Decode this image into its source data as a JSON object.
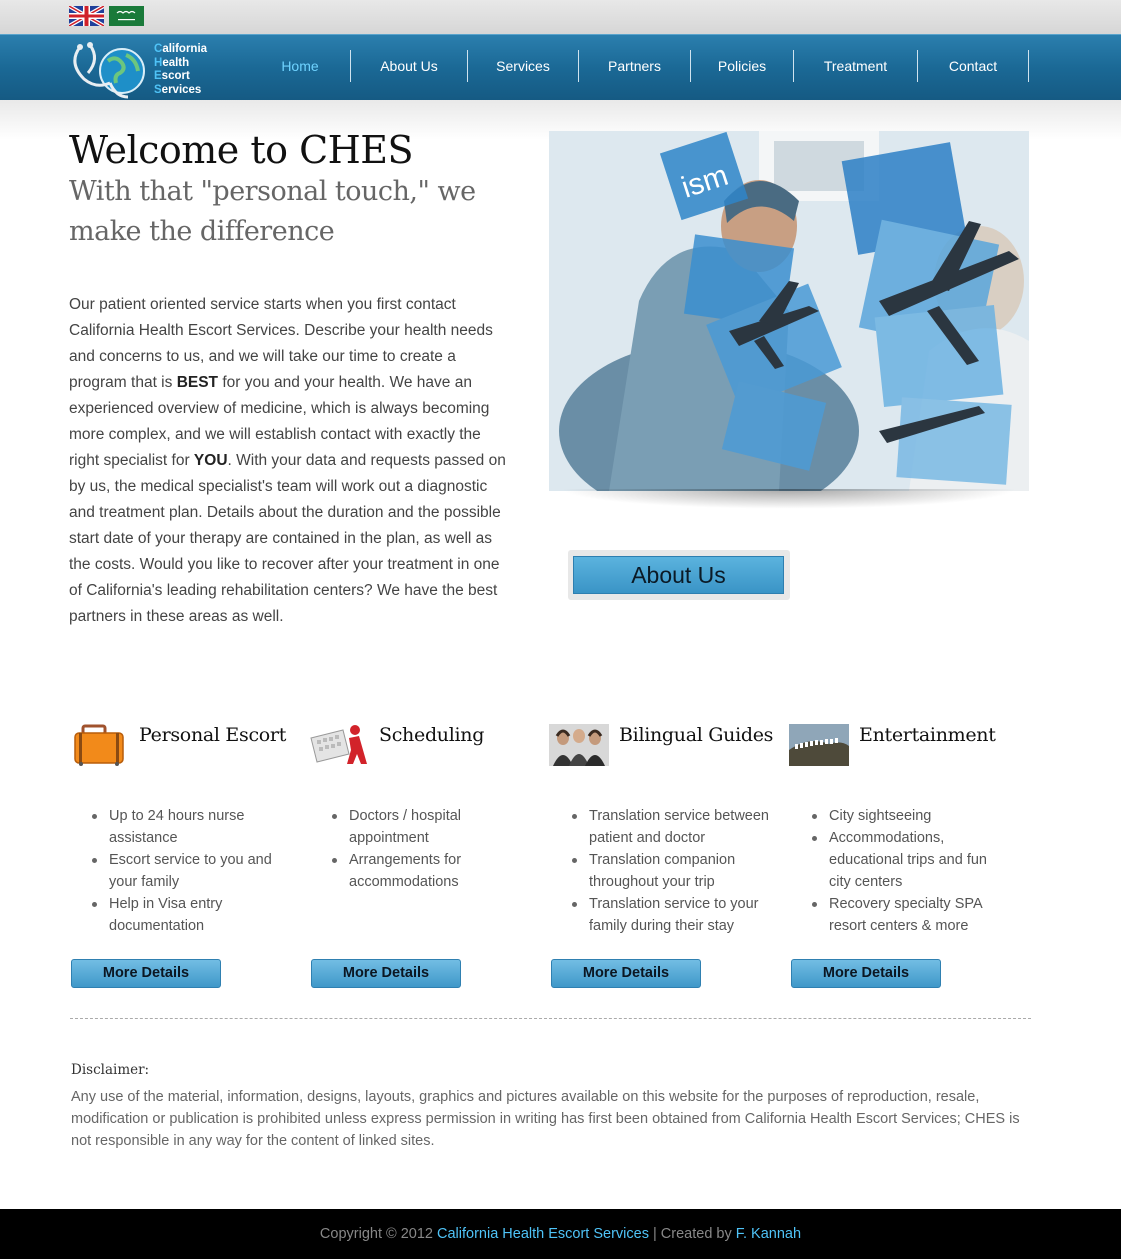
{
  "languages": [
    {
      "name": "english-flag-icon"
    },
    {
      "name": "arabic-flag-icon"
    }
  ],
  "logo": {
    "lines": [
      {
        "initial": "C",
        "rest": "alifornia"
      },
      {
        "initial": "H",
        "rest": "ealth"
      },
      {
        "initial": "E",
        "rest": "scort"
      },
      {
        "initial": "S",
        "rest": "ervices"
      }
    ]
  },
  "nav": {
    "items": [
      "Home",
      "About Us",
      "Services",
      "Partners",
      "Policies",
      "Treatment",
      "Contact"
    ],
    "active": "Home"
  },
  "welcome": {
    "title": "Welcome to CHES",
    "subtitle": "With that \"personal touch,\" we make the difference",
    "intro_parts": [
      "Our patient oriented service starts when you first contact California Health Escort Services. Describe your health needs and concerns to us, and we will take our time to create a program that is ",
      "BEST",
      " for you and your health. We have an experienced overview of medicine, which is always becoming more complex, and we will establish contact with exactly the right specialist for ",
      "YOU",
      ". With your data and requests passed on by us, the medical specialist's team will work out a diagnostic and treatment plan. Details about the duration and the possible start date of your therapy are contained in the plan, as well as the costs. Would you like to recover after your treatment in one of California's leading rehabilitation centers? We have the best partners in these areas as well."
    ]
  },
  "hero": {
    "tile_text": "ism"
  },
  "about_button": "About Us",
  "features": [
    {
      "title": "Personal Escort",
      "icon": "suitcase-icon",
      "items": [
        "Up to 24 hours nurse assistance",
        "Escort service to you and your family",
        "Help in Visa entry documentation"
      ],
      "button": "More Details"
    },
    {
      "title": "Scheduling",
      "icon": "calendar-icon",
      "items": [
        "Doctors / hospital appointment",
        "Arrangements for accommodations"
      ],
      "button": "More Details"
    },
    {
      "title": "Bilingual Guides",
      "icon": "guides-photo-icon",
      "items": [
        "Translation service between patient and doctor",
        "Translation companion throughout your trip",
        "Translation service to your family during their stay"
      ],
      "button": "More Details"
    },
    {
      "title": "Entertainment",
      "icon": "hollywood-sign-icon",
      "items": [
        "City sightseeing",
        "Accommodations, educational trips and fun city centers",
        "Recovery specialty SPA resort centers & more"
      ],
      "button": "More Details"
    }
  ],
  "disclaimer": {
    "label": "Disclaimer:",
    "text": "Any use of the material, information, designs, layouts, graphics and pictures available on this website for the purposes of reproduction, resale, modification or publication is prohibited unless express permission in writing has first been obtained from California Health Escort Services; CHES is not responsible in any way for the content of linked sites."
  },
  "footer": {
    "copyright": "Copyright © 2012 ",
    "company": "California Health Escort Services",
    "separator": " | Created by ",
    "author": "F. Kannah"
  },
  "colors": {
    "nav_bg": "#1b6996",
    "nav_active": "#6fd3ff",
    "button_blue": "#3f98c9",
    "footer_link": "#4fc3f7"
  }
}
